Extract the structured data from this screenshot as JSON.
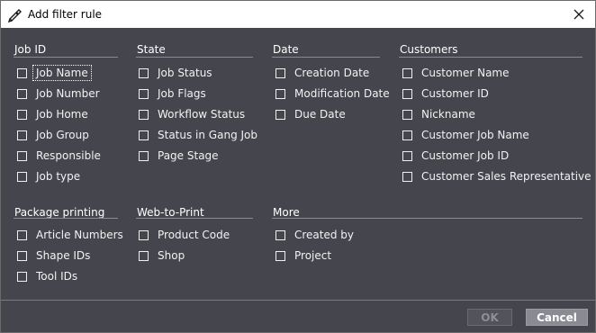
{
  "window": {
    "title": "Add filter rule"
  },
  "sections": [
    {
      "header": "Job ID",
      "items": [
        "Job Name",
        "Job Number",
        "Job Home",
        "Job Group",
        "Responsible",
        "Job type"
      ]
    },
    {
      "header": "State",
      "items": [
        "Job Status",
        "Job Flags",
        "Workflow Status",
        "Status in Gang Job",
        "Page Stage"
      ]
    },
    {
      "header": "Date",
      "items": [
        "Creation Date",
        "Modification Date",
        "Due Date"
      ]
    },
    {
      "header": "Customers",
      "items": [
        "Customer Name",
        "Customer ID",
        "Nickname",
        "Customer Job Name",
        "Customer Job ID",
        "Customer Sales Representative"
      ]
    },
    {
      "header": "Package printing",
      "items": [
        "Article Numbers",
        "Shape IDs",
        "Tool IDs"
      ]
    },
    {
      "header": "Web-to-Print",
      "items": [
        "Product Code",
        "Shop"
      ]
    },
    {
      "header": "More",
      "items": [
        "Created by",
        "Project"
      ]
    }
  ],
  "buttons": {
    "ok": "OK",
    "cancel": "Cancel"
  },
  "icons": {
    "title": "pen-nib-icon",
    "close": "close-icon"
  }
}
